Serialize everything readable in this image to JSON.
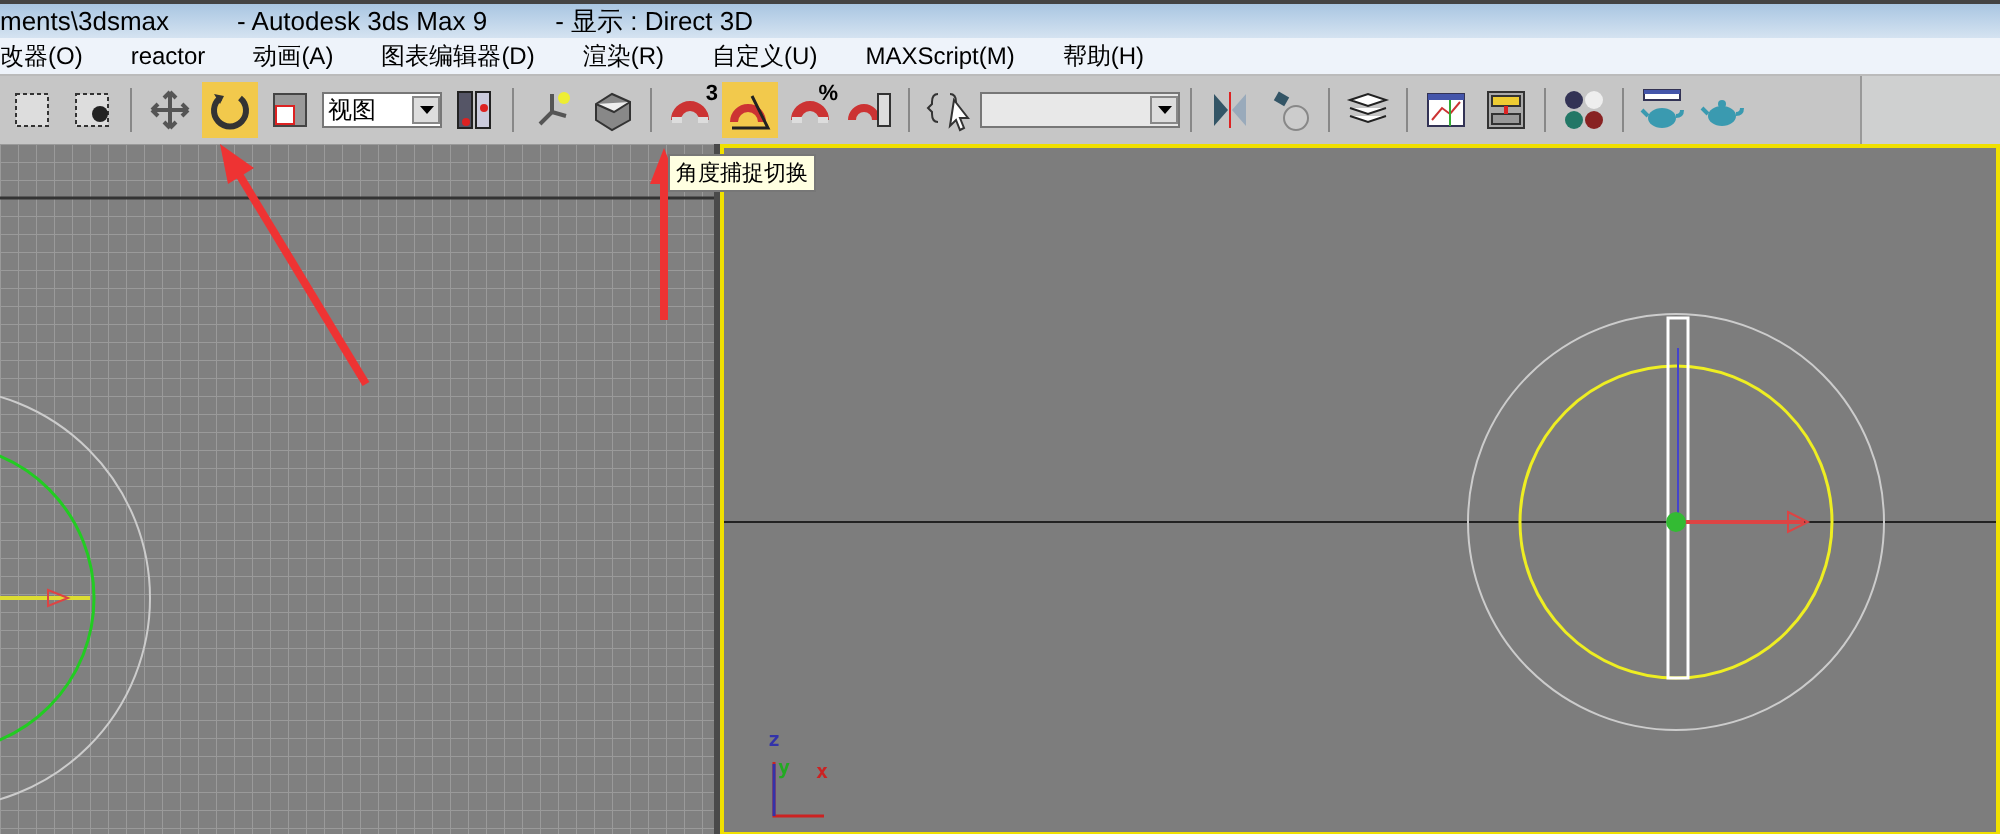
{
  "window": {
    "title_parts": [
      "ments\\3dsmax",
      "- Autodesk 3ds Max 9",
      "- 显示 : Direct 3D"
    ]
  },
  "menu": [
    "改器(O)",
    "reactor",
    "动画(A)",
    "图表编辑器(D)",
    "渲染(R)",
    "自定义(U)",
    "MAXScript(M)",
    "帮助(H)"
  ],
  "toolbar": [
    {
      "kind": "button",
      "selected": false
    },
    {
      "kind": "button",
      "selected": false
    },
    {
      "kind": "sep"
    },
    {
      "kind": "button",
      "selected": false
    },
    {
      "kind": "button",
      "selected": true
    },
    {
      "kind": "button",
      "selected": false
    },
    {
      "kind": "dropdown",
      "value": "视图"
    },
    {
      "kind": "button",
      "selected": false
    },
    {
      "kind": "sep"
    },
    {
      "kind": "button",
      "selected": false
    },
    {
      "kind": "button",
      "selected": false
    },
    {
      "kind": "sep"
    },
    {
      "kind": "button",
      "selected": false,
      "label": "3"
    },
    {
      "kind": "button",
      "selected": true
    },
    {
      "kind": "button",
      "selected": false,
      "label": "%"
    },
    {
      "kind": "button",
      "selected": false
    },
    {
      "kind": "sep"
    },
    {
      "kind": "button",
      "selected": false
    },
    {
      "kind": "dropdown"
    },
    {
      "kind": "sep"
    },
    {
      "kind": "button",
      "selected": false
    },
    {
      "kind": "button",
      "selected": false
    },
    {
      "kind": "sep"
    },
    {
      "kind": "button",
      "selected": false
    },
    {
      "kind": "sep"
    },
    {
      "kind": "button",
      "selected": false
    },
    {
      "kind": "button",
      "selected": false
    },
    {
      "kind": "sep"
    },
    {
      "kind": "button",
      "selected": false
    },
    {
      "kind": "sep"
    },
    {
      "kind": "button",
      "selected": false
    },
    {
      "kind": "button",
      "selected": false
    }
  ],
  "tooltip": "角度捕捉切换",
  "viewports": [
    {
      "active": false
    },
    {
      "active": true,
      "axis_labels": [
        "z",
        "y",
        "x"
      ]
    }
  ]
}
